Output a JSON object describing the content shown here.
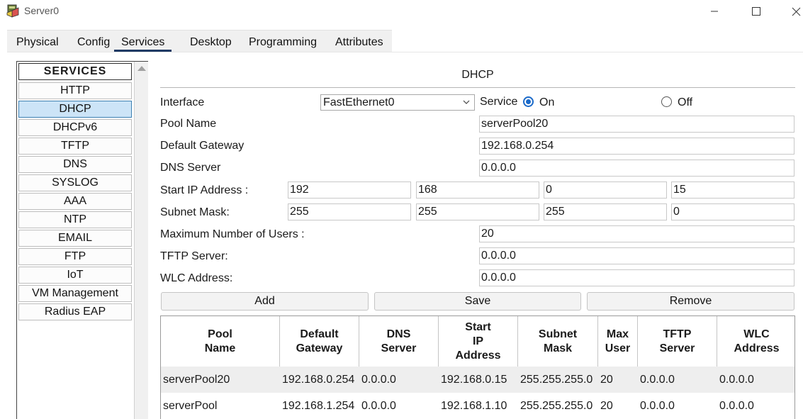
{
  "window": {
    "title": "Server0",
    "controls": [
      "minimize-icon",
      "maximize-icon",
      "close-icon"
    ]
  },
  "tabs": [
    {
      "label": "Physical",
      "active": false
    },
    {
      "label": "Config",
      "active": false
    },
    {
      "label": "Services",
      "active": true
    },
    {
      "label": "Desktop",
      "active": false
    },
    {
      "label": "Programming",
      "active": false
    },
    {
      "label": "Attributes",
      "active": false
    }
  ],
  "sidebar": {
    "header": "SERVICES",
    "items": [
      {
        "label": "HTTP",
        "selected": false
      },
      {
        "label": "DHCP",
        "selected": true
      },
      {
        "label": "DHCPv6",
        "selected": false
      },
      {
        "label": "TFTP",
        "selected": false
      },
      {
        "label": "DNS",
        "selected": false
      },
      {
        "label": "SYSLOG",
        "selected": false
      },
      {
        "label": "AAA",
        "selected": false
      },
      {
        "label": "NTP",
        "selected": false
      },
      {
        "label": "EMAIL",
        "selected": false
      },
      {
        "label": "FTP",
        "selected": false
      },
      {
        "label": "IoT",
        "selected": false
      },
      {
        "label": "VM Management",
        "selected": false
      },
      {
        "label": "Radius EAP",
        "selected": false
      }
    ]
  },
  "dhcp": {
    "title": "DHCP",
    "interface_label": "Interface",
    "interface_value": "FastEthernet0",
    "service_label": "Service",
    "on_label": "On",
    "off_label": "Off",
    "service_on": true,
    "pool_name_label": "Pool Name",
    "pool_name": "serverPool20",
    "gateway_label": "Default Gateway",
    "gateway": "192.168.0.254",
    "dns_label": "DNS Server",
    "dns": "0.0.0.0",
    "start_ip_label": "Start IP Address :",
    "start_ip": [
      "192",
      "168",
      "0",
      "15"
    ],
    "subnet_label": "Subnet Mask:",
    "subnet": [
      "255",
      "255",
      "255",
      "0"
    ],
    "max_users_label": "Maximum Number of Users :",
    "max_users": "20",
    "tftp_label": "TFTP Server:",
    "tftp": "0.0.0.0",
    "wlc_label": "WLC Address:",
    "wlc": "0.0.0.0",
    "add_label": "Add",
    "save_label": "Save",
    "remove_label": "Remove"
  },
  "table": {
    "headers": [
      "Pool\nName",
      "Default\nGateway",
      "DNS\nServer",
      "Start\nIP\nAddress",
      "Subnet\nMask",
      "Max\nUser",
      "TFTP\nServer",
      "WLC\nAddress"
    ],
    "rows": [
      [
        "serverPool20",
        "192.168.0.254",
        "0.0.0.0",
        "192.168.0.15",
        "255.255.255.0",
        "20",
        "0.0.0.0",
        "0.0.0.0"
      ],
      [
        "serverPool",
        "192.168.1.254",
        "0.0.0.0",
        "192.168.1.10",
        "255.255.255.0",
        "20",
        "0.0.0.0",
        "0.0.0.0"
      ]
    ]
  },
  "colors": {
    "accent": "#1b6ac9",
    "selected_bg": "#cce4f7",
    "tab_underline": "#1f3a64"
  }
}
